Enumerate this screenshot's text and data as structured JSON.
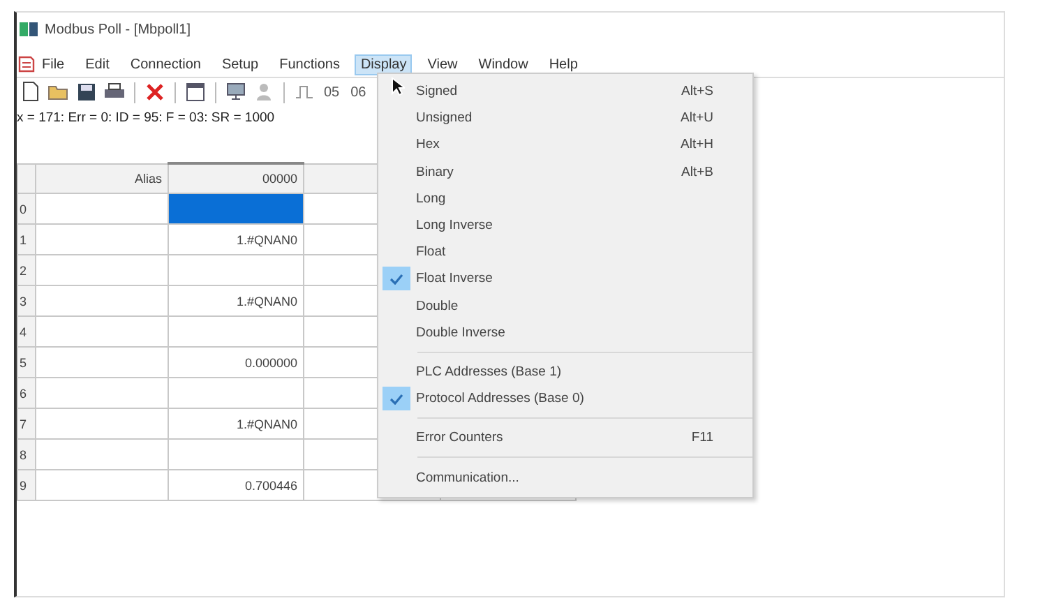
{
  "window": {
    "title": "Modbus Poll - [Mbpoll1]"
  },
  "menu_bar": {
    "items": [
      {
        "label": "File",
        "selected": false
      },
      {
        "label": "Edit",
        "selected": false
      },
      {
        "label": "Connection",
        "selected": false
      },
      {
        "label": "Setup",
        "selected": false
      },
      {
        "label": "Functions",
        "selected": false
      },
      {
        "label": "Display",
        "selected": true
      },
      {
        "label": "View",
        "selected": false
      },
      {
        "label": "Window",
        "selected": false
      },
      {
        "label": "Help",
        "selected": false
      }
    ]
  },
  "toolbar": {
    "function_buttons": [
      "05",
      "06"
    ]
  },
  "status_line": "x = 171: Err = 0: ID = 95: F = 03: SR = 1000",
  "table": {
    "columns": [
      "Alias",
      "00000"
    ],
    "rows": [
      {
        "label": "0",
        "selected": true
      },
      {
        "label": "1",
        "value": "1.#QNAN0",
        "selected": false
      },
      {
        "label": "2",
        "selected": false
      },
      {
        "label": "3",
        "value": "1.#QNAN0",
        "selected": false
      },
      {
        "label": "4",
        "selected": false
      },
      {
        "label": "5",
        "value": "0.000000",
        "selected": false
      },
      {
        "label": "6",
        "selected": false
      },
      {
        "label": "7",
        "value": "1.#QNAN0",
        "selected": false
      },
      {
        "label": "8",
        "selected": false
      },
      {
        "label": "9",
        "value": "0.700446",
        "selected": false
      }
    ]
  },
  "dropdown_menu": {
    "items": [
      {
        "kind": "item",
        "label": "Signed",
        "shortcut": "Alt+S",
        "checked": false
      },
      {
        "kind": "item",
        "label": "Unsigned",
        "shortcut": "Alt+U",
        "checked": false
      },
      {
        "kind": "item",
        "label": "Hex",
        "shortcut": "Alt+H",
        "checked": false
      },
      {
        "kind": "item",
        "label": "Binary",
        "shortcut": "Alt+B",
        "checked": false
      },
      {
        "kind": "item",
        "label": "Long",
        "checked": false
      },
      {
        "kind": "item",
        "label": "Long Inverse",
        "checked": false
      },
      {
        "kind": "item",
        "label": "Float",
        "checked": false
      },
      {
        "kind": "item",
        "label": "Float Inverse",
        "checked": true
      },
      {
        "kind": "item",
        "label": "Double",
        "checked": false
      },
      {
        "kind": "item",
        "label": "Double Inverse",
        "checked": false
      },
      {
        "kind": "separator"
      },
      {
        "kind": "item",
        "label": "PLC Addresses (Base 1)",
        "checked": false
      },
      {
        "kind": "item",
        "label": "Protocol Addresses (Base 0)",
        "checked": true
      },
      {
        "kind": "separator"
      },
      {
        "kind": "item",
        "label": "Error Counters",
        "shortcut": "F11",
        "checked": false
      },
      {
        "kind": "separator"
      },
      {
        "kind": "item",
        "label": "Communication...",
        "checked": false
      }
    ]
  }
}
